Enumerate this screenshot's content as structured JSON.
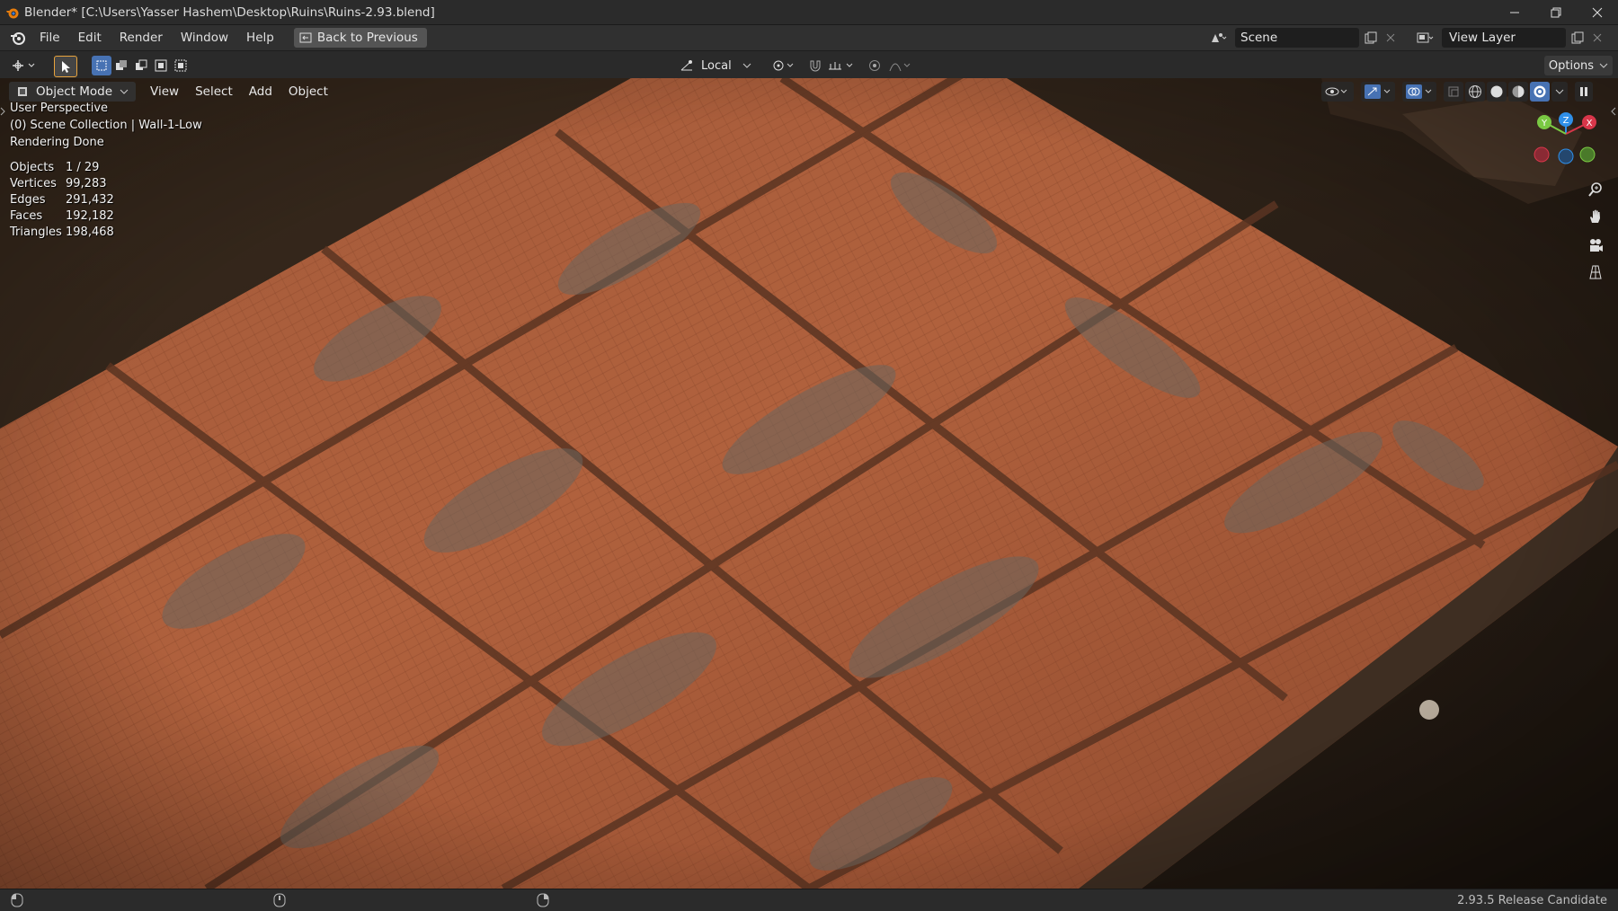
{
  "window": {
    "title": "Blender* [C:\\Users\\Yasser Hashem\\Desktop\\Ruins\\Ruins-2.93.blend]"
  },
  "menu": {
    "items": [
      "File",
      "Edit",
      "Render",
      "Window",
      "Help"
    ],
    "back_label": "Back to Previous"
  },
  "scene": {
    "name": "Scene",
    "view_layer": "View Layer"
  },
  "toolbar": {
    "transform_orientation": "Local",
    "options_label": "Options"
  },
  "viewport": {
    "mode": "Object Mode",
    "header_menus": [
      "View",
      "Select",
      "Add",
      "Object"
    ],
    "info_lines": [
      "User Perspective",
      "(0) Scene Collection | Wall-1-Low",
      "Rendering Done"
    ],
    "stats": [
      {
        "label": "Objects",
        "value": "1 / 29"
      },
      {
        "label": "Vertices",
        "value": "99,283"
      },
      {
        "label": "Edges",
        "value": "291,432"
      },
      {
        "label": "Faces",
        "value": "192,182"
      },
      {
        "label": "Triangles",
        "value": "198,468"
      }
    ],
    "gizmo": {
      "x": "X",
      "y": "Y",
      "z": "Z"
    }
  },
  "status": {
    "version": "2.93.5 Release Candidate"
  },
  "colors": {
    "accent": "#4772b3",
    "axis_x": "#d8364a",
    "axis_y": "#7ac943",
    "axis_z": "#2f8fe8"
  }
}
